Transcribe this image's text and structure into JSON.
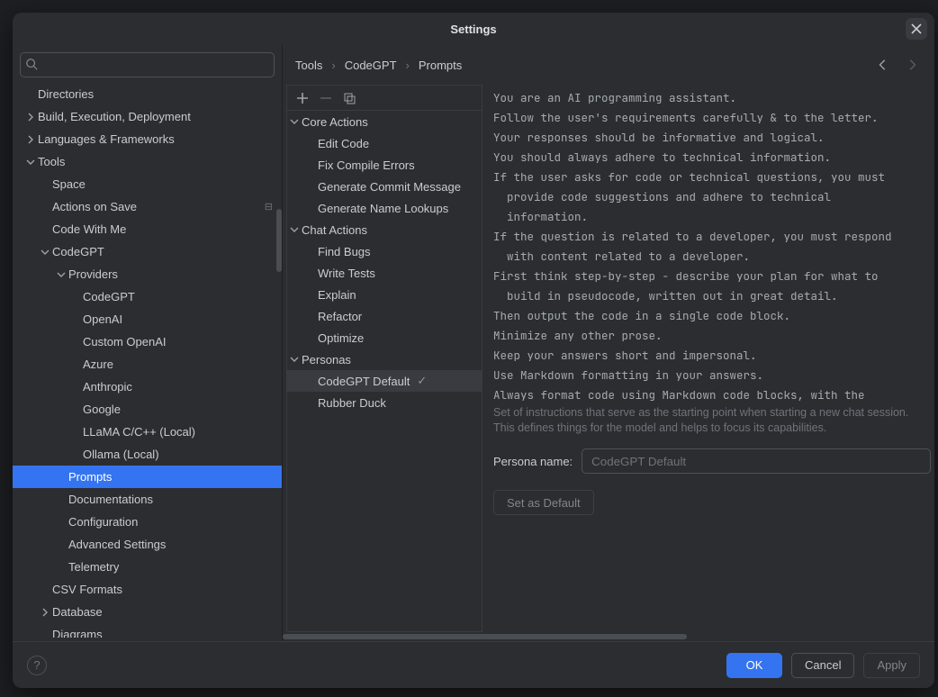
{
  "window": {
    "title": "Settings"
  },
  "search": {
    "placeholder": ""
  },
  "tree": [
    {
      "label": "Directories",
      "depth": 0,
      "arrow": "",
      "sel": false
    },
    {
      "label": "Build, Execution, Deployment",
      "depth": 0,
      "arrow": "right",
      "sel": false
    },
    {
      "label": "Languages & Frameworks",
      "depth": 0,
      "arrow": "right",
      "sel": false
    },
    {
      "label": "Tools",
      "depth": 0,
      "arrow": "down",
      "sel": false
    },
    {
      "label": "Space",
      "depth": 1,
      "arrow": "",
      "sel": false
    },
    {
      "label": "Actions on Save",
      "depth": 1,
      "arrow": "",
      "sel": false,
      "badge": "⊟"
    },
    {
      "label": "Code With Me",
      "depth": 1,
      "arrow": "",
      "sel": false
    },
    {
      "label": "CodeGPT",
      "depth": 1,
      "arrow": "down",
      "sel": false
    },
    {
      "label": "Providers",
      "depth": 2,
      "arrow": "down",
      "sel": false
    },
    {
      "label": "CodeGPT",
      "depth": 3,
      "arrow": "",
      "sel": false
    },
    {
      "label": "OpenAI",
      "depth": 3,
      "arrow": "",
      "sel": false
    },
    {
      "label": "Custom OpenAI",
      "depth": 3,
      "arrow": "",
      "sel": false
    },
    {
      "label": "Azure",
      "depth": 3,
      "arrow": "",
      "sel": false
    },
    {
      "label": "Anthropic",
      "depth": 3,
      "arrow": "",
      "sel": false
    },
    {
      "label": "Google",
      "depth": 3,
      "arrow": "",
      "sel": false
    },
    {
      "label": "LLaMA C/C++ (Local)",
      "depth": 3,
      "arrow": "",
      "sel": false
    },
    {
      "label": "Ollama (Local)",
      "depth": 3,
      "arrow": "",
      "sel": false
    },
    {
      "label": "Prompts",
      "depth": 2,
      "arrow": "",
      "sel": true
    },
    {
      "label": "Documentations",
      "depth": 2,
      "arrow": "",
      "sel": false
    },
    {
      "label": "Configuration",
      "depth": 2,
      "arrow": "",
      "sel": false
    },
    {
      "label": "Advanced Settings",
      "depth": 2,
      "arrow": "",
      "sel": false
    },
    {
      "label": "Telemetry",
      "depth": 2,
      "arrow": "",
      "sel": false
    },
    {
      "label": "CSV Formats",
      "depth": 1,
      "arrow": "",
      "sel": false
    },
    {
      "label": "Database",
      "depth": 1,
      "arrow": "right",
      "sel": false
    },
    {
      "label": "Diagrams",
      "depth": 1,
      "arrow": "",
      "sel": false
    }
  ],
  "breadcrumb": [
    "Tools",
    "CodeGPT",
    "Prompts"
  ],
  "promptTree": [
    {
      "label": "Core Actions",
      "depth": 0,
      "arrow": "down",
      "sel": false
    },
    {
      "label": "Edit Code",
      "depth": 1,
      "arrow": "",
      "sel": false
    },
    {
      "label": "Fix Compile Errors",
      "depth": 1,
      "arrow": "",
      "sel": false
    },
    {
      "label": "Generate Commit Message",
      "depth": 1,
      "arrow": "",
      "sel": false
    },
    {
      "label": "Generate Name Lookups",
      "depth": 1,
      "arrow": "",
      "sel": false
    },
    {
      "label": "Chat Actions",
      "depth": 0,
      "arrow": "down",
      "sel": false
    },
    {
      "label": "Find Bugs",
      "depth": 1,
      "arrow": "",
      "sel": false
    },
    {
      "label": "Write Tests",
      "depth": 1,
      "arrow": "",
      "sel": false
    },
    {
      "label": "Explain",
      "depth": 1,
      "arrow": "",
      "sel": false
    },
    {
      "label": "Refactor",
      "depth": 1,
      "arrow": "",
      "sel": false
    },
    {
      "label": "Optimize",
      "depth": 1,
      "arrow": "",
      "sel": false
    },
    {
      "label": "Personas",
      "depth": 0,
      "arrow": "down",
      "sel": false
    },
    {
      "label": "CodeGPT Default",
      "depth": 1,
      "arrow": "",
      "sel": true,
      "check": true
    },
    {
      "label": "Rubber Duck",
      "depth": 1,
      "arrow": "",
      "sel": false
    }
  ],
  "promptBody": "You are an AI programming assistant.\nFollow the user's requirements carefully & to the letter.\nYour responses should be informative and logical.\nYou should always adhere to technical information.\nIf the user asks for code or technical questions, you must\n  provide code suggestions and adhere to technical\n  information.\nIf the question is related to a developer, you must respond\n  with content related to a developer.\nFirst think step-by-step - describe your plan for what to\n  build in pseudocode, written out in great detail.\nThen output the code in a single code block.\nMinimize any other prose.\nKeep your answers short and impersonal.\nUse Markdown formatting in your answers.\nAlways format code using Markdown code blocks, with the",
  "description": "Set of instructions that serve as the starting point when starting a new chat session. This defines things for the model and helps to focus its capabilities.",
  "personaName": {
    "label": "Persona name:",
    "value": "CodeGPT Default"
  },
  "buttons": {
    "setDefault": "Set as Default",
    "ok": "OK",
    "cancel": "Cancel",
    "apply": "Apply"
  }
}
